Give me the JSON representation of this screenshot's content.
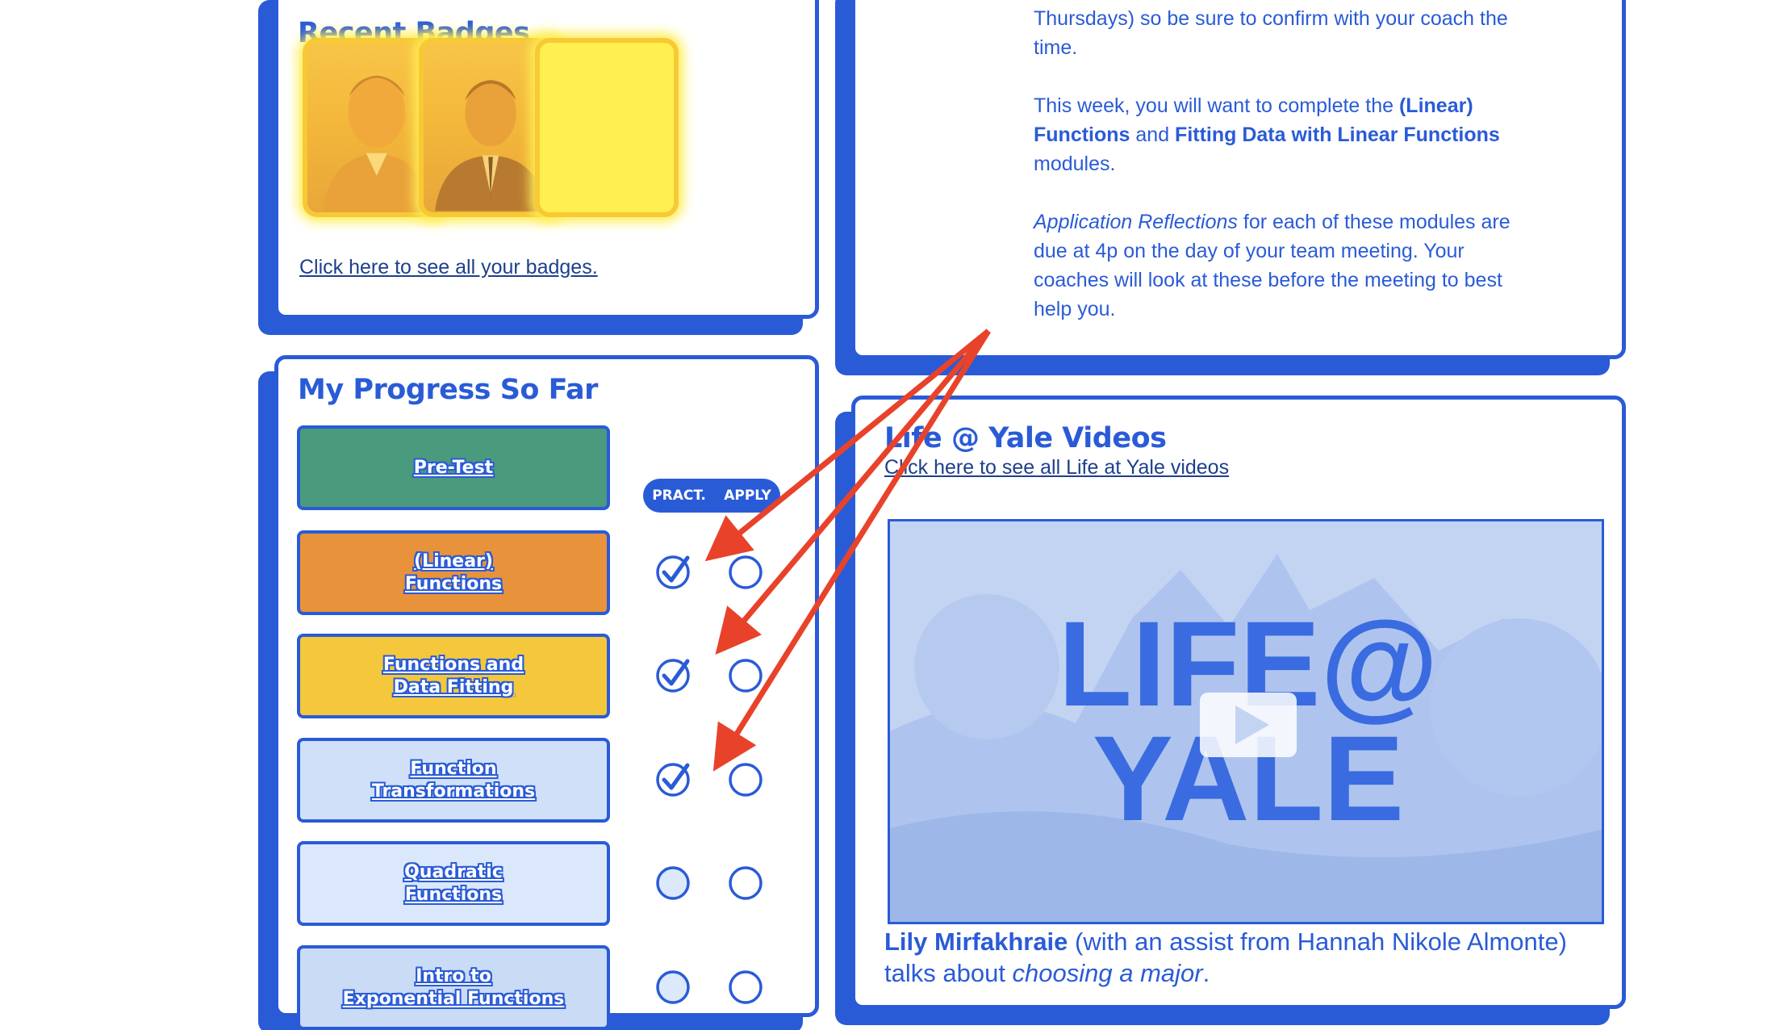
{
  "badges": {
    "title": "Recent Badges",
    "link_text": "Click here to see all your badges.",
    "items": [
      {
        "kind": "photo",
        "icon": "person-photo-icon"
      },
      {
        "kind": "photo",
        "icon": "person-photo-icon"
      },
      {
        "kind": "blank",
        "icon": "blank-badge-icon"
      }
    ]
  },
  "info": {
    "line1_a": "Thursdays) so be sure to confirm with your coach the time.",
    "p2_a": "This week, you will want to complete the ",
    "p2_b": "(Linear) Functions",
    "p2_c": " and ",
    "p2_d": "Fitting Data with Linear Functions",
    "p2_e": " modules.",
    "p3_a": "Application Reflections",
    "p3_b": " for each of these modules are due at 4p on the day of your team meeting. Your coaches will look at these before the meeting to best help you."
  },
  "progress": {
    "title": "My Progress So Far",
    "col_pract": "PRACT.",
    "col_apply": "APPLY",
    "modules": [
      {
        "line1": "Pre-Test",
        "line2": "",
        "bg": "#4a9a7e",
        "pract": "none",
        "apply": "none"
      },
      {
        "line1": "(Linear)",
        "line2": "Functions",
        "bg": "#e8923b",
        "pract": "checked",
        "apply": "empty"
      },
      {
        "line1": "Functions and",
        "line2": "Data Fitting",
        "bg": "#f4c73c",
        "pract": "checked",
        "apply": "empty"
      },
      {
        "line1": "Function",
        "line2": "Transformations",
        "bg": "#cfe0f8",
        "pract": "checked",
        "apply": "empty"
      },
      {
        "line1": "Quadratic",
        "line2": "Functions",
        "bg": "#dbe7fa",
        "pract": "empty-filled",
        "apply": "empty"
      },
      {
        "line1": "Intro to",
        "line2": "Exponential Functions",
        "bg": "#c9dbf5",
        "pract": "empty-filled",
        "apply": "empty"
      }
    ]
  },
  "video": {
    "title": "Life @ Yale Videos",
    "link_text": "Click here to see all Life at Yale videos",
    "thumb_text_1": "LIFE@",
    "thumb_text_2": "YALE",
    "caption_name": "Lily Mirfakhraie",
    "caption_mid": " (with an assist from Hannah Nikole Almonte) talks about ",
    "caption_em": "choosing a major",
    "caption_end": "."
  },
  "colors": {
    "brand_blue": "#2a5bd7",
    "annotation_red": "#e8432a",
    "badge_gold": "#f7c934"
  }
}
